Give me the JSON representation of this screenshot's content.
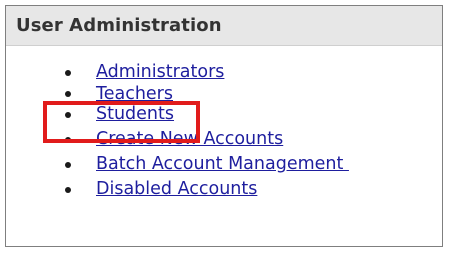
{
  "panel": {
    "title": "User Administration"
  },
  "links": [
    {
      "label": "Administrators"
    },
    {
      "label": "Teachers"
    },
    {
      "label": "Students"
    },
    {
      "label": "Create New Accounts"
    },
    {
      "label": "Batch Account Management "
    },
    {
      "label": "Disabled Accounts"
    }
  ],
  "colors": {
    "header_background": "#e7e7e7",
    "link": "#1e1e9e",
    "highlight": "#e11b1b"
  }
}
